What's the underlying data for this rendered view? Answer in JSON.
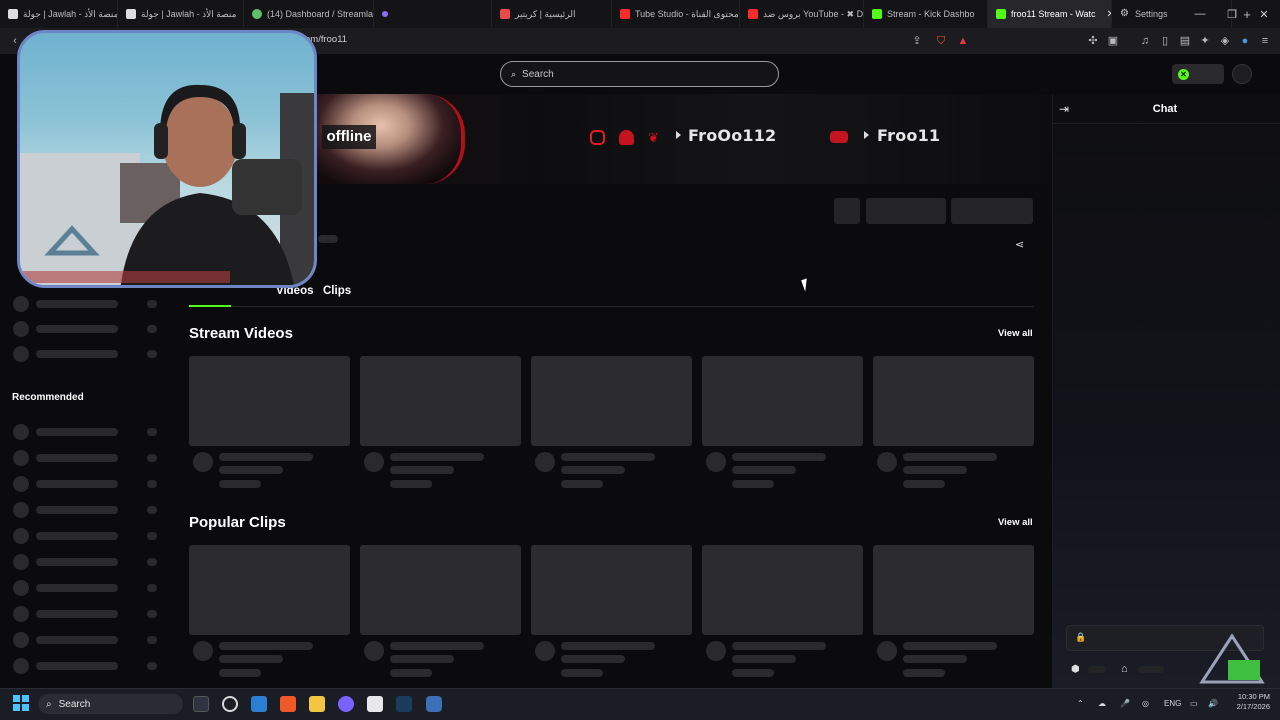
{
  "browser": {
    "tabs": [
      {
        "label": "جولة | Jawlah - منصة الأذ",
        "color": "#ffffff"
      },
      {
        "label": "جولة | Jawlah - منصة الأذ",
        "color": "#ffffff"
      },
      {
        "label": "(14) Dashboard / Streamla",
        "color": "#5fbf6a"
      },
      {
        "label": "",
        "color": "#8c6cff"
      },
      {
        "label": "الرئيسية | كريتير",
        "color": "#e84a4a"
      },
      {
        "label": "Tube Studio - محتوى القناة",
        "color": "#ff2a2a"
      },
      {
        "label": "بروس ضد YouTube - ✖ D",
        "color": "#ff2a2a"
      },
      {
        "label": "Stream - Kick Dashbo",
        "color": "#53fc18"
      },
      {
        "label": "froo11 Stream - Watc",
        "color": "#53fc18"
      },
      {
        "label": "Settings",
        "color": "#cccccc"
      }
    ],
    "new_tab": "+",
    "url": "om/froo11"
  },
  "search": {
    "placeholder": "Search"
  },
  "banner": {
    "status": "offline",
    "handle1": "FroOo112",
    "handle2": "Froo11"
  },
  "tabs": {
    "videos": "Videos",
    "clips": "Clips"
  },
  "sections": {
    "stream_videos": "Stream Videos",
    "popular_clips": "Popular Clips",
    "view_all": "View all"
  },
  "sidebar": {
    "recommended": "Recommended"
  },
  "chat": {
    "title": "Chat"
  },
  "taskbar": {
    "search": "Search",
    "lang": "ENG",
    "time": "10:30 PM",
    "date": "2/17/2026"
  },
  "colors": {
    "accent": "#53fc18",
    "offline_bg": "#141416",
    "banner_red": "#b0101a"
  }
}
